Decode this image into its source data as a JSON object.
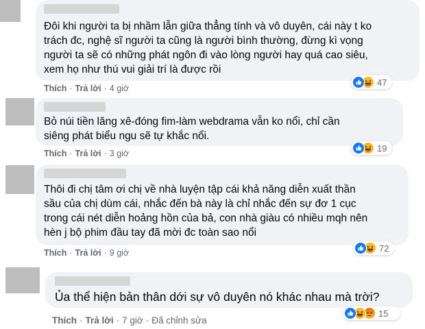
{
  "comments": [
    {
      "text": "Đôi khi người ta bị nhầm lẫn giữa thẳng tính và vô duyên, cái này t ko\ntrách đc, nghệ sĩ người ta cũng là người bình thường, đừng kì vọng\nngười ta sẽ có những phát ngôn đi vào lòng người hay quá cao siêu,\nxem họ như thú vui giải trí là được rồi",
      "like": "Thích",
      "reply": "Trả lời",
      "time": "4 giờ",
      "reactions": [
        "like",
        "haha"
      ],
      "count": "47"
    },
    {
      "text": "Bỏ núi tiền lăng xê-đóng fim-làm webdrama vẫn ko nổi, chỉ cần\nsiêng phát biểu ngu sẽ tự khắc nổi.",
      "like": "Thích",
      "reply": "Trả lời",
      "time": "3 giờ",
      "reactions": [
        "like",
        "haha"
      ],
      "count": "19"
    },
    {
      "text": "Thôi đi chị tâm ơi chị về nhà luyện tập cái khả năng diễn xuất thần\nsầu của chị dùm cái, nhắc đến bà này là chỉ nhắc đến sự đơ 1 cục\ntrong cái nét diễn hoảng hồn của bả, con nhà giàu có nhiều mqh nên\nhèn j bộ phim đầu tay đã mời đc toàn sao nổi",
      "like": "Thích",
      "reply": "Trả lời",
      "time": "9 giờ",
      "reactions": [
        "like",
        "haha"
      ],
      "count": "72"
    },
    {
      "text": "Ủa thể hiện bản thân dới sự vô duyên nó khác nhau mà trời?",
      "like": "Thích",
      "reply": "Trả lời",
      "time": "7 giờ",
      "edited": "Đã chỉnh sửa",
      "reactions": [
        "like",
        "haha",
        "angry"
      ],
      "count": "15"
    }
  ],
  "colors": {
    "like": "#1877f2",
    "haha": "#f7b928",
    "angry": "#e9710f",
    "bubble": "#f0f2f5",
    "meta": "#65676b"
  }
}
